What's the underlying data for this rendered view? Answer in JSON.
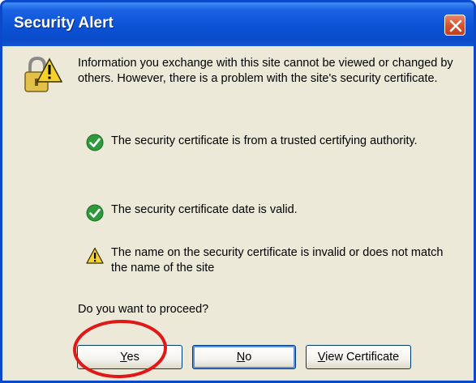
{
  "window": {
    "title": "Security Alert"
  },
  "dialog": {
    "intro": "Information you exchange with this site cannot be viewed or changed by others. However, there is a problem with the site's security certificate.",
    "items": [
      {
        "status": "ok",
        "icon": "check-icon",
        "text": "The security certificate is from a trusted certifying authority."
      },
      {
        "status": "ok",
        "icon": "check-icon",
        "text": "The security certificate date is valid."
      },
      {
        "status": "warning",
        "icon": "warning-icon",
        "text": "The name on the security certificate is invalid or does not match the name of the site"
      }
    ],
    "question": "Do you want to proceed?"
  },
  "buttons": {
    "yes": {
      "mnemonic": "Y",
      "rest": "es"
    },
    "no": {
      "mnemonic": "N",
      "rest": "o"
    },
    "view": {
      "mnemonic": "V",
      "rest": "iew Certificate"
    }
  },
  "colors": {
    "title_bar": "#0a4bc8",
    "dialog_bg": "#ece9d8",
    "ok_green": "#2e9a3c",
    "warning_yellow": "#f5d12a",
    "annotation_red": "#e01818"
  }
}
